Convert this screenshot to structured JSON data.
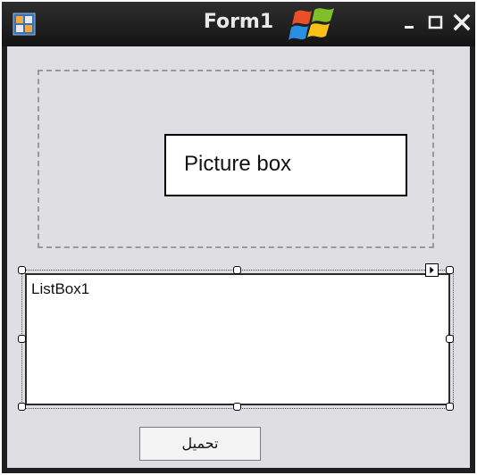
{
  "window": {
    "title": "Form1"
  },
  "titlebar_buttons": {
    "minimize": "_",
    "maximize": "□",
    "close": "✕"
  },
  "picture_box": {
    "label": "Picture box"
  },
  "listbox": {
    "label": "ListBox1"
  },
  "load_button": {
    "label": "تحميل"
  },
  "colors": {
    "titlebar": "#1f1f1f",
    "client_background": "#dedee3",
    "button_background": "#f4f4f4"
  },
  "icons": {
    "app": "form-app-icon",
    "logo": "windows-logo-icon",
    "smart_tag": "smart-tag-arrow-icon"
  }
}
